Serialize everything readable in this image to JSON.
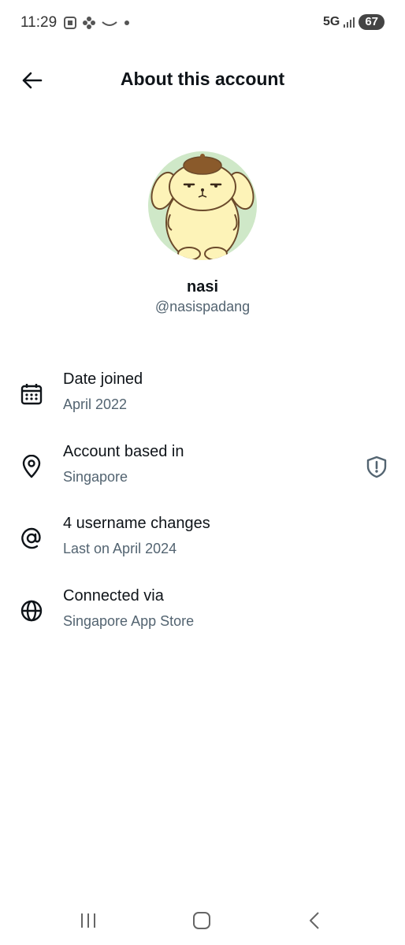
{
  "status_bar": {
    "time": "11:29",
    "network": "5G",
    "battery": "67",
    "icons": [
      "screenshot-icon",
      "flower-icon",
      "smile-icon",
      "dot-icon",
      "signal-icon"
    ]
  },
  "header": {
    "title": "About this account",
    "back_icon": "arrow-left-icon"
  },
  "profile": {
    "name": "nasi",
    "handle": "@nasispadang",
    "avatar_bg": "#cfe8c8"
  },
  "rows": [
    {
      "icon": "calendar-icon",
      "title": "Date joined",
      "subtitle": "April 2022"
    },
    {
      "icon": "location-pin-icon",
      "title": "Account based in",
      "subtitle": "Singapore",
      "trailing_icon": "shield-alert-icon"
    },
    {
      "icon": "at-sign-icon",
      "title": "4 username changes",
      "subtitle": "Last on April 2024"
    },
    {
      "icon": "globe-icon",
      "title": "Connected via",
      "subtitle": "Singapore App Store"
    }
  ],
  "nav_bar": {
    "icons": [
      "recents-icon",
      "home-icon",
      "back-icon"
    ]
  },
  "colors": {
    "text_primary": "#0f1419",
    "text_secondary": "#536471",
    "background": "#ffffff"
  }
}
